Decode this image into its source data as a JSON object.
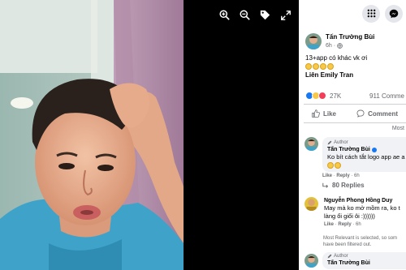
{
  "viewer": {
    "tools": [
      "zoom-in",
      "zoom-out",
      "tag",
      "fullscreen"
    ]
  },
  "post": {
    "author": "Tấn Trường Bùi",
    "time": "6h",
    "text_line1": "13+app có khác vk ơi",
    "mention": "Liên Emily Tran",
    "reaction_count": "27K",
    "comment_count": "911 Comme",
    "like_label": "Like",
    "comment_label": "Comment",
    "sort_label": "Most"
  },
  "comments": [
    {
      "badge": "Author",
      "author": "Tấn Trường Bùi",
      "text": "Ko bít cách tắt logo app ae a",
      "like": "Like",
      "reply": "Reply",
      "time": "6h",
      "replies": "80 Replies"
    },
    {
      "author": "Nguyễn Phong Hồng Duy",
      "text_line1": "May mà ko mở mồm ra, ko t",
      "text_line2": "làng ổi giổi ôi :))))))",
      "like": "Like",
      "reply": "Reply",
      "time": "6h"
    },
    {
      "badge": "Author",
      "author": "Tấn Trường Bùi"
    }
  ],
  "notice": "Most Relevant is selected, so som",
  "notice_line2": "have been filtered out.",
  "colors": {
    "accent": "#1877f2",
    "like_blue": "#1877f2",
    "love_red": "#f33e58",
    "haha_yellow": "#f7c948"
  }
}
